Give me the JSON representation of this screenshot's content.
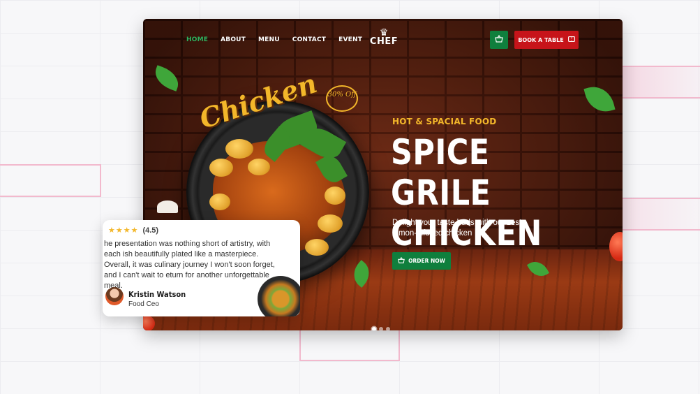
{
  "nav": {
    "items": [
      {
        "label": "HOME",
        "active": true
      },
      {
        "label": "ABOUT",
        "active": false
      },
      {
        "label": "MENU",
        "active": false
      },
      {
        "label": "CONTACT",
        "active": false
      },
      {
        "label": "EVENT",
        "active": false
      }
    ],
    "logo_text": "CHEF",
    "cart_icon": "basket-icon",
    "book_label": "BOOK A TABLE",
    "book_icon": "ticket-icon"
  },
  "hero": {
    "dish_script": "Chicken",
    "discount_badge": "30% Off",
    "kicker": "HOT & SPACIAL FOOD",
    "headline_line1": "SPICE GRILE",
    "headline_line2": "CHICKEN",
    "description": "Delight your taste buds with our zesty lemon-infused chicken",
    "order_label": "ORDER NOW",
    "slider": {
      "count": 3,
      "active": 1
    }
  },
  "review": {
    "stars": "★★★★",
    "rating": "(4.5)",
    "text": "he presentation was nothing short of artistry, with each ish beautifully plated like a masterpiece. Overall, it was culinary journey I won't soon forget, and I can't wait to eturn for another unforgettable meal.",
    "name": "Kristin Watson",
    "role": "Food Ceo"
  },
  "colors": {
    "accent_green": "#0f7f3d",
    "accent_red": "#c7141a",
    "accent_yellow": "#f3b72a",
    "active_nav": "#2fb35f"
  }
}
